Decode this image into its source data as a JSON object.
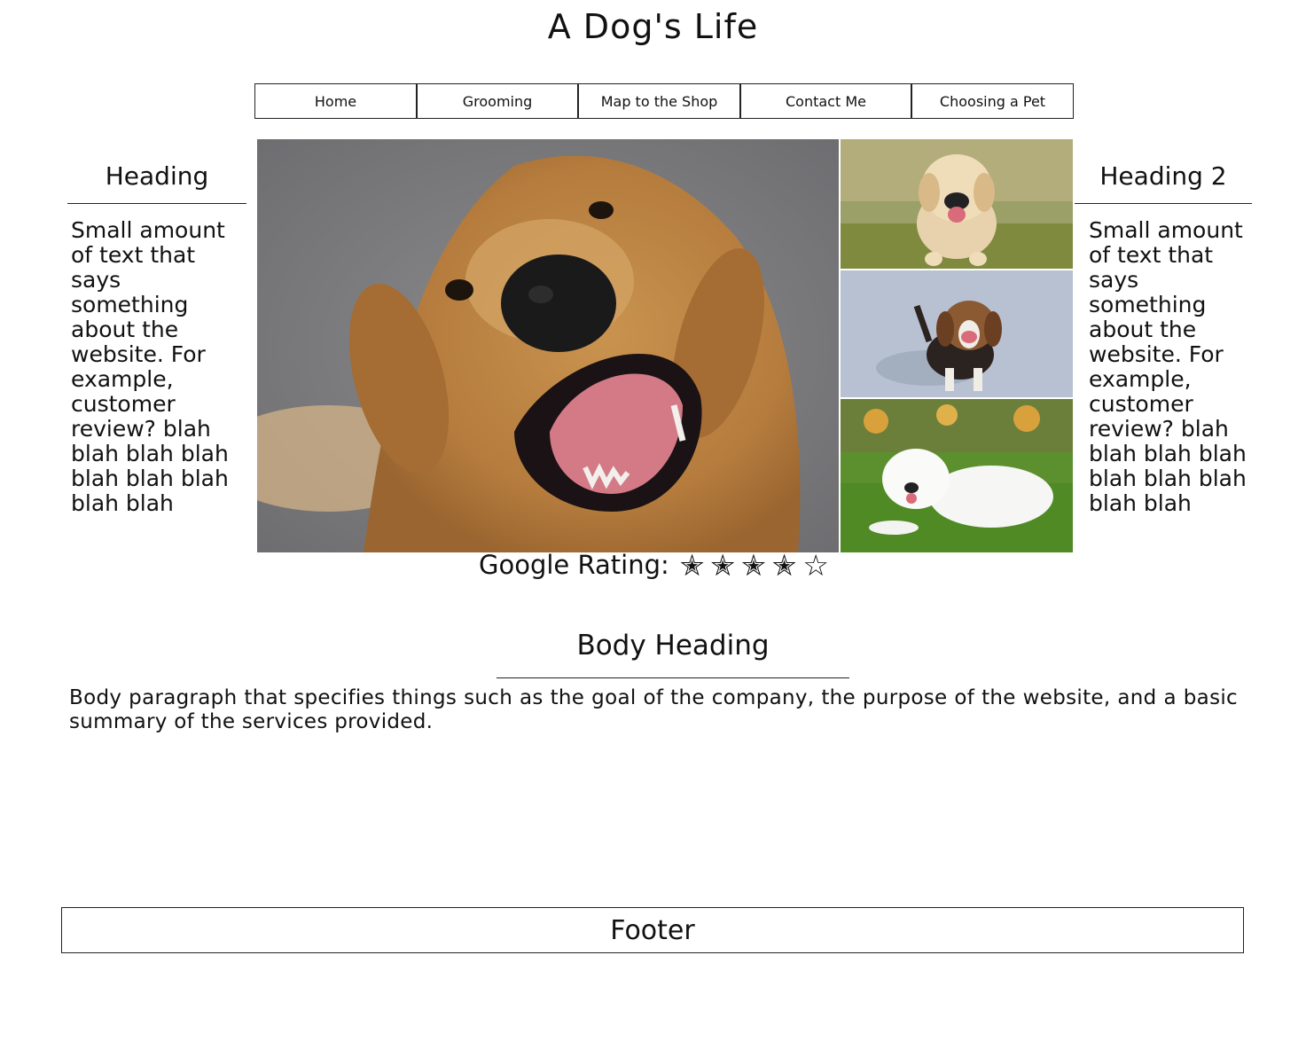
{
  "site": {
    "title": "A Dog's Life"
  },
  "nav": {
    "items": [
      {
        "label": "Home"
      },
      {
        "label": "Grooming"
      },
      {
        "label": "Map to the Shop"
      },
      {
        "label": "Contact Me"
      },
      {
        "label": "Choosing a Pet"
      }
    ]
  },
  "left": {
    "heading": "Heading",
    "text": "Small amount of text that says something about the website. For example, customer review? blah blah blah blah blah blah blah blah blah"
  },
  "right": {
    "heading": "Heading 2",
    "text": "Small amount of text that says something about the website. For example, customer review? blah blah blah blah blah blah blah blah blah"
  },
  "images": {
    "main": "golden-retriever-photo",
    "side": [
      "golden-puppy-photo",
      "beagle-puppy-photo",
      "samoyed-puppy-photo"
    ]
  },
  "rating": {
    "label": "Google Rating:",
    "filled": 4,
    "total": 5
  },
  "body": {
    "heading": "Body Heading",
    "paragraph": "Body paragraph that specifies things such as the goal of the company, the purpose of the website, and a basic summary of the services provided."
  },
  "footer": {
    "label": "Footer"
  }
}
